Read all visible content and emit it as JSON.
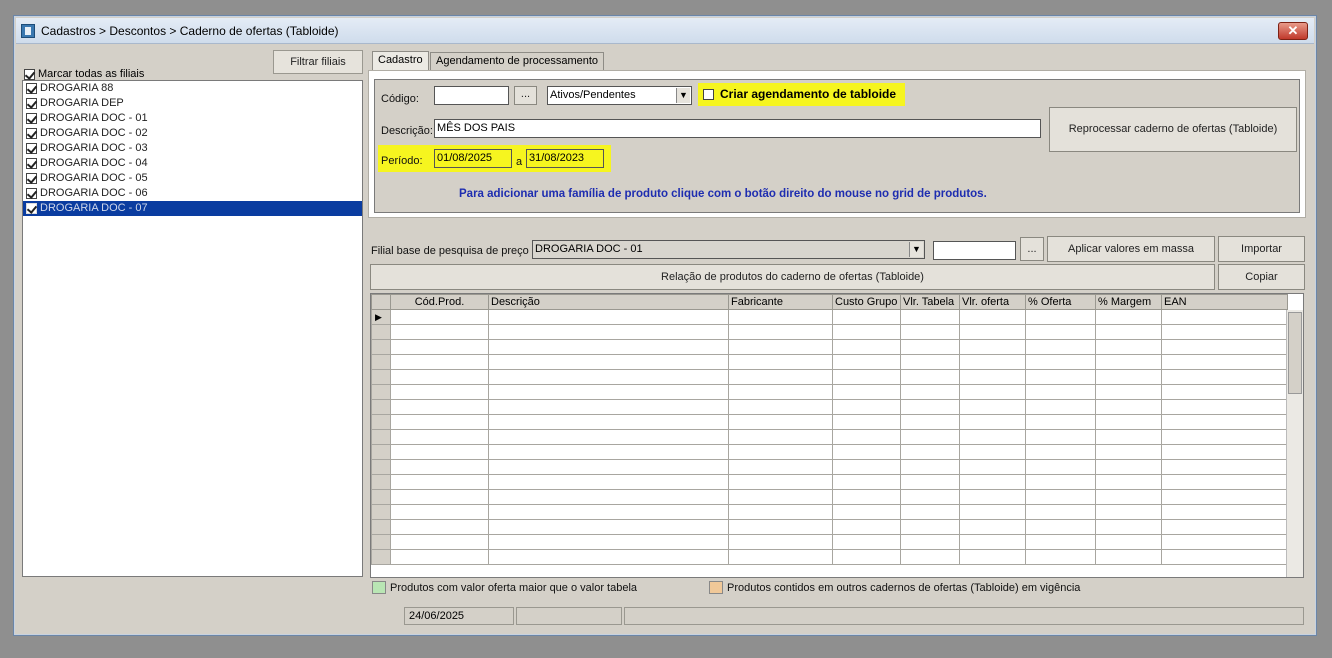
{
  "window": {
    "title": "Cadastros > Descontos > Caderno de ofertas (Tabloide)",
    "close_label": "✕"
  },
  "left": {
    "filter_button": "Filtrar filiais",
    "mark_all_label": "Marcar todas as filiais",
    "filiais": [
      {
        "label": "DROGARIA 88",
        "checked": true
      },
      {
        "label": "DROGARIA DEP",
        "checked": true
      },
      {
        "label": "DROGARIA DOC - 01",
        "checked": true
      },
      {
        "label": "DROGARIA DOC - 02",
        "checked": true
      },
      {
        "label": "DROGARIA DOC - 03",
        "checked": true
      },
      {
        "label": "DROGARIA DOC - 04",
        "checked": true
      },
      {
        "label": "DROGARIA DOC - 05",
        "checked": true
      },
      {
        "label": "DROGARIA DOC - 06",
        "checked": true
      },
      {
        "label": "DROGARIA DOC - 07",
        "checked": true,
        "selected": true
      }
    ]
  },
  "tabs": [
    {
      "label": "Cadastro",
      "active": true
    },
    {
      "label": "Agendamento de processamento",
      "active": false
    }
  ],
  "form": {
    "codigo_label": "Código:",
    "codigo_value": "",
    "codigo_lookup": "...",
    "status_select": "Ativos/Pendentes",
    "criar_agendamento_label": "Criar agendamento de tabloide",
    "descricao_label": "Descrição:",
    "descricao_value": "MÊS DOS PAIS",
    "reprocessar_button": "Reprocessar caderno de ofertas (Tabloide)",
    "periodo_label": "Período:",
    "periodo_inicio": "01/08/2025",
    "periodo_sep": "a",
    "periodo_fim": "31/08/2023",
    "info_text": "Para adicionar uma família de produto clique com o botão direito do  mouse no grid de produtos."
  },
  "toolbar": {
    "filial_base_label": "Filial base de pesquisa de preço",
    "filial_base_value": "DROGARIA DOC - 01",
    "lookup_value": "",
    "lookup_btn": "...",
    "aplicar_button": "Aplicar valores em massa",
    "importar_button": "Importar",
    "relacao_button": "Relação de produtos do caderno de ofertas (Tabloide)",
    "copiar_button": "Copiar"
  },
  "grid": {
    "columns": [
      "Cód.Prod.",
      "Descrição",
      "Fabricante",
      "Custo Grupo",
      "Vlr. Tabela",
      "Vlr. oferta",
      "% Oferta",
      "% Margem",
      "EAN"
    ],
    "empty_rows": 17
  },
  "legend": [
    {
      "label": "Produtos com valor oferta maior que o valor tabela",
      "color": "#b9e6b4"
    },
    {
      "label": "Produtos contidos em outros cadernos de ofertas (Tabloide) em vigência",
      "color": "#f0c898"
    }
  ],
  "status": {
    "date": "24/06/2025"
  },
  "colors": {
    "highlight": "#f6f51f",
    "selection": "#0a3ca0",
    "info_text": "#1e2db0"
  }
}
